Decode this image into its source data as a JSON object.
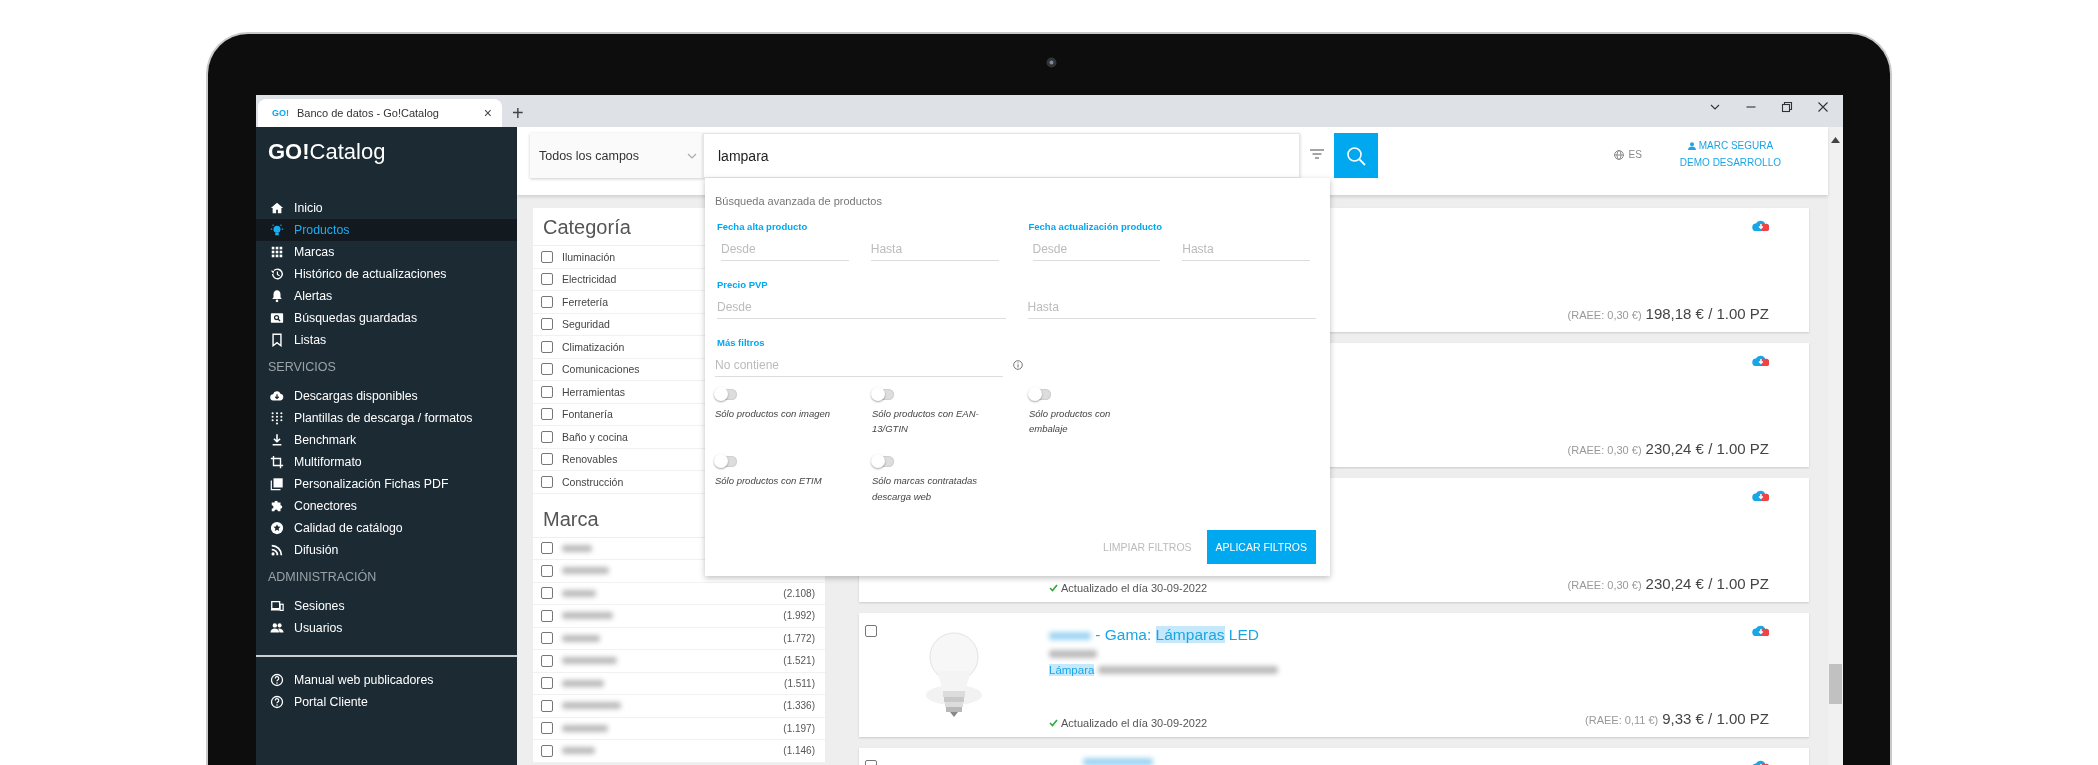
{
  "browser": {
    "tab_logo": "GO!",
    "tab_title": "Banco de datos - Go!Catalog",
    "close_tab": "×",
    "new_tab": "+"
  },
  "sidebar": {
    "logo": "**GO!**Catalog",
    "sections": [
      {
        "items": [
          {
            "label": "Inicio",
            "selected": false
          },
          {
            "label": "Productos",
            "selected": true
          },
          {
            "label": "Marcas",
            "selected": false
          },
          {
            "label": "Histórico de actualizaciones",
            "selected": false
          },
          {
            "label": "Alertas",
            "selected": false
          },
          {
            "label": "Búsquedas guardadas",
            "selected": false
          },
          {
            "label": "Listas",
            "selected": false
          }
        ]
      },
      {
        "heading": "SERVICIOS",
        "items": [
          {
            "label": "Descargas disponibles",
            "selected": false
          },
          {
            "label": "Plantillas de descarga / formatos",
            "selected": false
          },
          {
            "label": "Benchmark",
            "selected": false
          },
          {
            "label": "Multiformato",
            "selected": false
          },
          {
            "label": "Personalización Fichas PDF",
            "selected": false
          },
          {
            "label": "Conectores",
            "selected": false
          },
          {
            "label": "Calidad de catálogo",
            "selected": false
          },
          {
            "label": "Difusión",
            "selected": false
          }
        ]
      },
      {
        "heading": "ADMINISTRACIÓN",
        "items": [
          {
            "label": "Sesiones",
            "selected": false
          },
          {
            "label": "Usuarios",
            "selected": false
          }
        ]
      }
    ],
    "footer_items": [
      {
        "label": "Manual web publicadores",
        "selected": false
      },
      {
        "label": "Portal Cliente",
        "selected": false
      }
    ]
  },
  "header": {
    "search_scope": "Todos los campos",
    "search_value": "lampara",
    "language": "ES",
    "user": "MARC SEGURA",
    "company": "DEMO DESARROLLO"
  },
  "filters": {
    "category_title": "Categoría",
    "categories": [
      {
        "label": "Iluminación",
        "checked": false
      },
      {
        "label": "Electricidad",
        "checked": false
      },
      {
        "label": "Ferretería",
        "checked": false
      },
      {
        "label": "Seguridad",
        "checked": false
      },
      {
        "label": "Climatización",
        "checked": false
      },
      {
        "label": "Comunicaciones",
        "checked": false
      },
      {
        "label": "Herramientas",
        "checked": false
      },
      {
        "label": "Fontanería",
        "checked": false
      },
      {
        "label": "Baño y cocina",
        "checked": false
      },
      {
        "label": "Renovables",
        "checked": false
      },
      {
        "label": "Construcción",
        "checked": false
      }
    ],
    "brand_title": "Marca",
    "brands": [
      {
        "checked": false
      },
      {
        "checked": false
      },
      {
        "checked": false,
        "count": "(2.108)"
      },
      {
        "checked": false,
        "count": "(1.992)"
      },
      {
        "checked": false,
        "count": "(1.772)"
      },
      {
        "checked": false,
        "count": "(1.521)"
      },
      {
        "checked": false,
        "count": "(1.511)"
      },
      {
        "checked": false,
        "count": "(1.336)"
      },
      {
        "checked": false,
        "count": "(1.197)"
      },
      {
        "checked": false,
        "count": "(1.146)"
      }
    ]
  },
  "advanced_search": {
    "title": "Búsqueda avanzada de productos",
    "date_groups": [
      {
        "label": "Fecha alta producto",
        "fields": [
          {
            "placeholder": "Desde"
          },
          {
            "placeholder": "Hasta"
          }
        ]
      },
      {
        "label": "Fecha actualización producto",
        "fields": [
          {
            "placeholder": "Desde"
          },
          {
            "placeholder": "Hasta"
          }
        ]
      }
    ],
    "price": {
      "label": "Precio PVP",
      "fields": [
        {
          "placeholder": "Desde"
        },
        {
          "placeholder": "Hasta"
        }
      ]
    },
    "more": {
      "label": "Más filtros",
      "placeholder": "No contiene"
    },
    "toggles": [
      {
        "label": "Sólo productos con imagen",
        "on": false
      },
      {
        "label": "Sólo productos con EAN-13/GTIN",
        "on": false
      },
      {
        "label": "Sólo productos con embalaje",
        "on": false
      },
      {
        "label": "Sólo productos con ETIM",
        "on": false
      },
      {
        "label": "Sólo marcas contratadas descarga web",
        "on": false
      }
    ],
    "buttons": [
      {
        "label": "LIMPIAR FILTROS",
        "kind": "text"
      },
      {
        "label": "APLICAR FILTROS",
        "kind": "primary"
      }
    ]
  },
  "results": [
    {
      "price_note": "(RAEE: 0,30 €)",
      "price": "198,18 € / 1.00 PZ"
    },
    {
      "price_note": "(RAEE: 0,30 €)",
      "price": "230,24 € / 1.00 PZ"
    },
    {
      "updated": "Actualizado el día 30-09-2022",
      "price_note": "(RAEE: 0,30 €)",
      "price": "230,24 € / 1.00 PZ"
    },
    {
      "checked": false,
      "title": [
        {
          "text": " - Gama: ",
          "highlight": false
        },
        {
          "text": "Lámparas",
          "highlight": true
        },
        {
          "text": " LED",
          "highlight": false
        }
      ],
      "subtitle": {
        "text": "Lámpara",
        "highlight": true
      },
      "updated": "Actualizado el día 30-09-2022",
      "price_note": "(RAEE: 0,11 €)",
      "price": "9,33 € / 1.00 PZ"
    },
    {
      "checked": false
    }
  ]
}
